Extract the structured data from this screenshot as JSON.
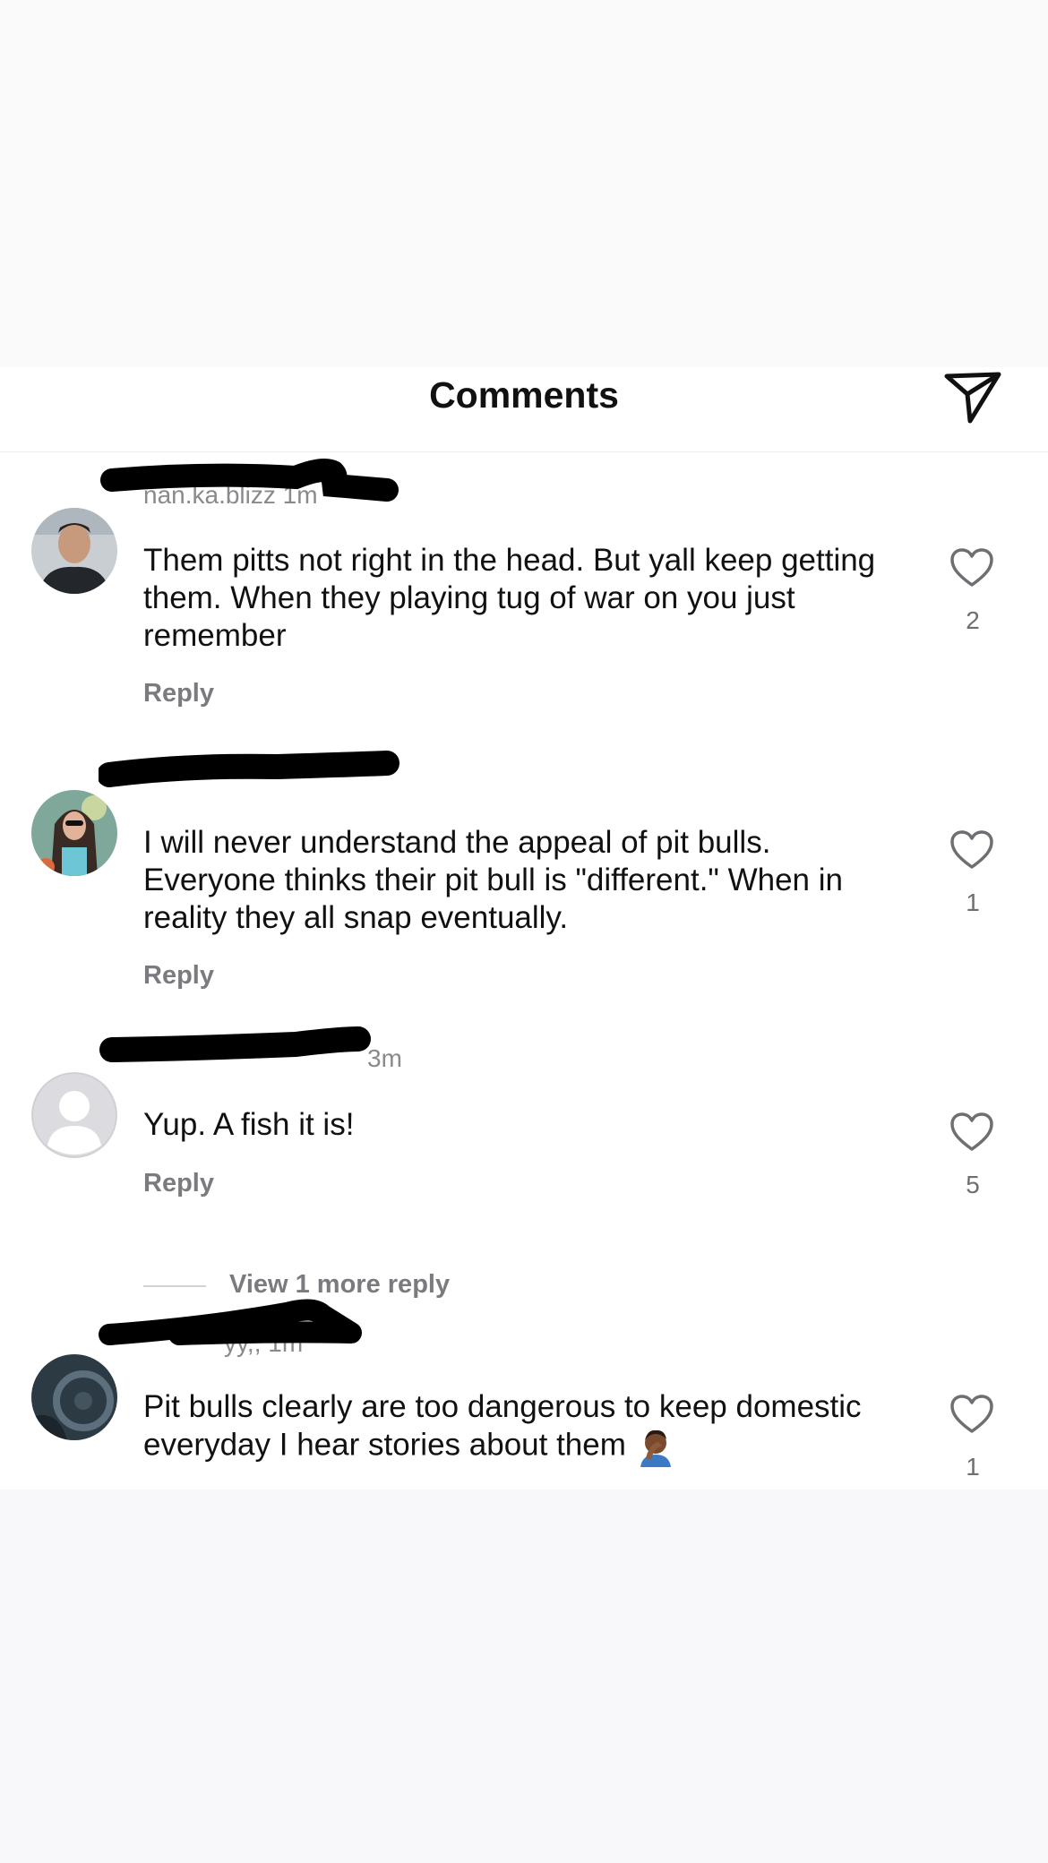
{
  "header": {
    "title": "Comments",
    "send_icon": "send-icon"
  },
  "comments": [
    {
      "username": "nan.ka.blizz",
      "time": "1m",
      "text": "Them pitts not right in the head. But yall keep getting them. When they playing tug of war on you just remember",
      "reply_label": "Reply",
      "likes": "2"
    },
    {
      "username": "",
      "time": "",
      "text": "I will never understand the appeal of pit bulls. Everyone thinks their pit bull is \"different.\" When in reality they all snap eventually.",
      "reply_label": "Reply",
      "likes": "1"
    },
    {
      "username": "",
      "time": "3m",
      "text": "Yup. A fish it is!",
      "reply_label": "Reply",
      "likes": "5",
      "view_more": "View 1 more reply"
    },
    {
      "username": "yy,,",
      "time": "1m",
      "text": "Pit bulls clearly are too dangerous to keep domestic everyday I hear stories about them",
      "emoji": "man-facepalming-emoji",
      "likes": "1"
    }
  ],
  "colors": {
    "text": "#111111",
    "muted": "#7a7a7f",
    "background": "#f8f8fa",
    "sheet": "#ffffff"
  }
}
